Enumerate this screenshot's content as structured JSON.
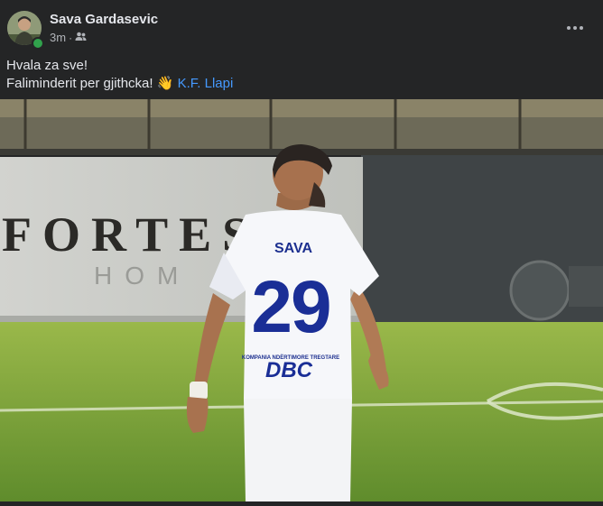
{
  "post": {
    "author": "Sava Gardasevic",
    "time": "3m",
    "separator": "·",
    "line1": "Hvala za sve!",
    "line2": "Faliminderit per gjithcka!",
    "emoji": "👋",
    "mention": "K.F. Llapi"
  },
  "photo": {
    "banner_text": "FORTES",
    "banner_sub": "HOM",
    "jersey_name": "SAVA",
    "jersey_number": "29",
    "jersey_sponsor": "DBC",
    "jersey_sponsor_small": "KOMPANIA NDËRTIMORE TREGTARE"
  },
  "icons": {
    "audience": "friends-icon",
    "menu": "more-options-icon"
  }
}
